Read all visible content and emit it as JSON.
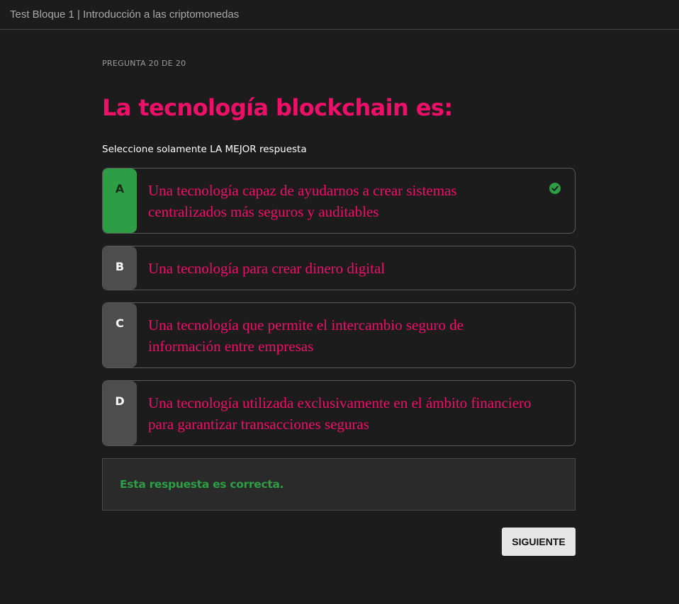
{
  "header": {
    "title": "Test Bloque 1 | Introducción a las criptomonedas"
  },
  "question": {
    "counter": "PREGUNTA 20 DE 20",
    "title": "La tecnología blockchain es:",
    "instruction": "Seleccione solamente LA MEJOR respuesta"
  },
  "options": [
    {
      "letter": "A",
      "text": "Una tecnología capaz de ayudarnos a crear sistemas centralizados más seguros y auditables",
      "state": "correct"
    },
    {
      "letter": "B",
      "text": "Una tecnología para crear dinero digital",
      "state": "default"
    },
    {
      "letter": "C",
      "text": "Una tecnología que permite el intercambio seguro de información entre empresas",
      "state": "default"
    },
    {
      "letter": "D",
      "text": "Una tecnología utilizada exclusivamente en el ámbito financiero para garantizar transacciones seguras",
      "state": "default"
    }
  ],
  "feedback": {
    "text": "Esta respuesta es correcta."
  },
  "actions": {
    "next_label": "SIGUIENTE"
  },
  "colors": {
    "accent": "#ee1068",
    "correct": "#2e9e46",
    "background": "#1c1c1c",
    "letter_default": "#4d4d4d"
  },
  "icons": {
    "correct_indicator": "check-circle-icon"
  }
}
